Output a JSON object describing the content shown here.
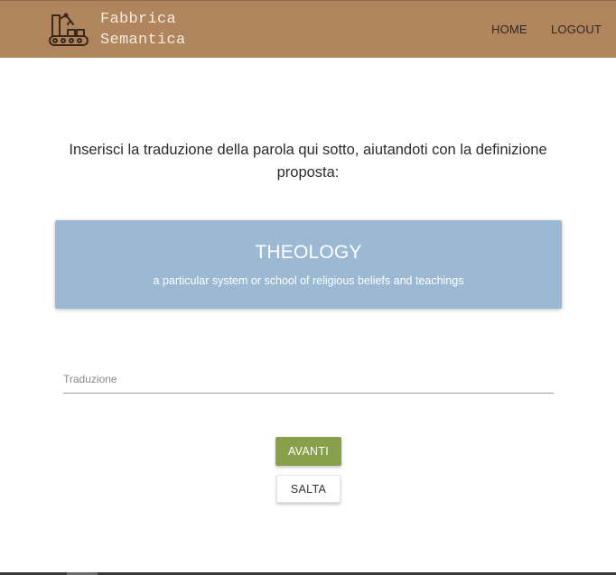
{
  "navbar": {
    "brand_line1": "Fabbrica",
    "brand_line2": "Semantica",
    "logo_icon": "factory-robot-arm-icon",
    "links": [
      {
        "label": "HOME"
      },
      {
        "label": "LOGOUT"
      }
    ],
    "background_color": "#b0845c"
  },
  "main": {
    "instruction": "Inserisci la traduzione della parola qui sotto, aiutandoti con la definizione proposta:",
    "card": {
      "word": "THEOLOGY",
      "definition": "a particular system or school of religious beliefs and teachings",
      "background_color": "#9bb9d3"
    },
    "translation_field": {
      "placeholder": "Traduzione",
      "value": ""
    },
    "buttons": {
      "next_label": "AVANTI",
      "skip_label": "SALTA",
      "next_color": "#89a04a"
    }
  }
}
